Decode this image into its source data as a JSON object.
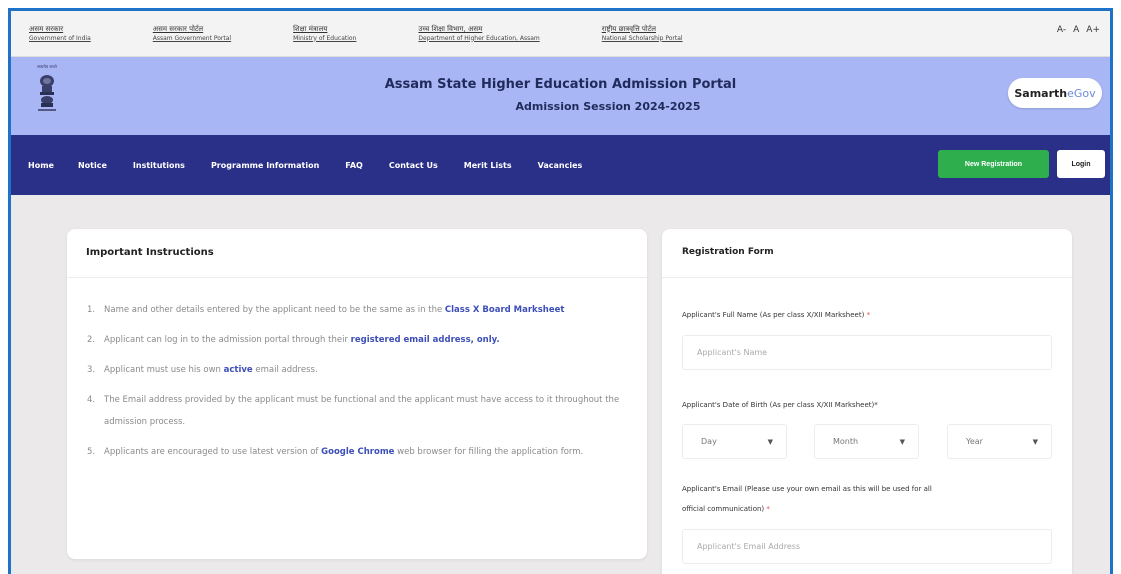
{
  "gov_links": [
    {
      "line1": "असम सरकार",
      "line2": "Government of India"
    },
    {
      "line1": "असम सरकार पोर्टल",
      "line2": "Assam Government Portal"
    },
    {
      "line1": "शिक्षा मंत्रालय",
      "line2": "Ministry of Education"
    },
    {
      "line1": "उच्च शिक्षा विभाग, असम",
      "line2": "Department of Higher Education, Assam"
    },
    {
      "line1": "राष्ट्रीय छात्रवृत्ति पोर्टल",
      "line2": "National Scholarship Portal"
    }
  ],
  "font_controls": {
    "small": "A-",
    "normal": "A",
    "large": "A+"
  },
  "header": {
    "title": "Assam State Higher Education Admission Portal",
    "subtitle": "Admission Session 2024-2025",
    "emblem_text": "सत्यमेव जयते",
    "logo_bold": "Samarth",
    "logo_light": "eGov"
  },
  "nav": {
    "items": [
      "Home",
      "Notice",
      "Institutions",
      "Programme Information",
      "FAQ",
      "Contact Us",
      "Merit Lists",
      "Vacancies"
    ],
    "register_label": "New Registration",
    "login_label": "Login"
  },
  "instructions": {
    "title": "Important Instructions",
    "items": [
      {
        "num": "1.",
        "pre": "Name and other details entered by the applicant need to be the same as in the ",
        "bold": "Class X Board Marksheet",
        "post": ""
      },
      {
        "num": "2.",
        "pre": "Applicant can log in to the admission portal through their ",
        "bold": "registered email address, only.",
        "post": ""
      },
      {
        "num": "3.",
        "pre": "Applicant must use his own ",
        "bold": "active",
        "post": " email address."
      },
      {
        "num": "4.",
        "pre": "The Email address provided by the applicant must be functional and the applicant must have access to it throughout the admission process.",
        "bold": "",
        "post": ""
      },
      {
        "num": "5.",
        "pre": "Applicants are encouraged to use latest version of ",
        "bold": "Google Chrome",
        "post": " web browser for filling the application form."
      }
    ]
  },
  "registration": {
    "title": "Registration Form",
    "name_label": "Applicant's Full Name (As per class X/XII Marksheet)",
    "name_placeholder": "Applicant's Name",
    "dob_label": "Applicant's Date of Birth (As per class X/XII Marksheet)*",
    "day": "Day",
    "month": "Month",
    "year": "Year",
    "email_label_1": "Applicant's Email (Please use your own email as this will be used for all",
    "email_label_2": "official communication)",
    "email_placeholder": "Applicant's Email Address",
    "required_mark": "*"
  },
  "colors": {
    "frame_border": "#1e73c8",
    "header_bg": "#a9b6f5",
    "nav_bg": "#2a2f88",
    "register_button": "#2fae4e",
    "highlight_text": "#3d4fb7"
  }
}
